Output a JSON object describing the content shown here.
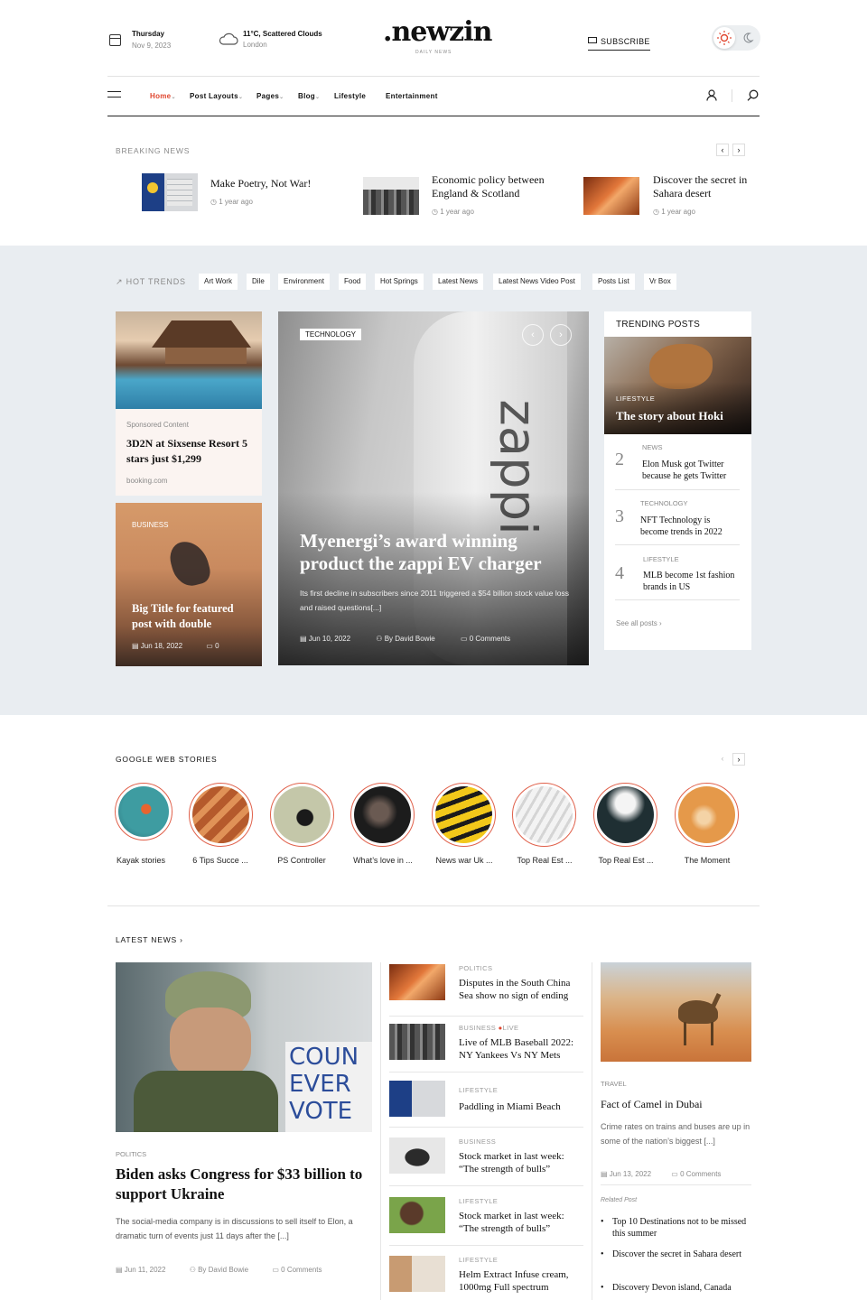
{
  "header": {
    "day": "Thursday",
    "date": "Nov 9, 2023",
    "weather": "11°C, Scattered Clouds",
    "city": "London",
    "logo": ".newzin",
    "logo_sub": "DAILY NEWS",
    "subscribe": "SUBSCRIBE"
  },
  "nav": {
    "items": [
      {
        "label": "Home",
        "active": true,
        "dropdown": true
      },
      {
        "label": "Post Layouts",
        "dropdown": true
      },
      {
        "label": "Pages",
        "dropdown": true
      },
      {
        "label": "Blog",
        "dropdown": true
      },
      {
        "label": "Lifestyle",
        "dropdown": false
      },
      {
        "label": "Entertainment",
        "dropdown": false
      }
    ]
  },
  "breaking": {
    "title": "BREAKING NEWS",
    "items": [
      {
        "title": "Make Poetry, Not War!",
        "time": "1 year ago"
      },
      {
        "title": "Economic policy between England & Scotland",
        "time": "1 year ago"
      },
      {
        "title": "Discover the secret in Sahara desert",
        "time": "1 year ago"
      }
    ]
  },
  "hot_trends": {
    "label": "HOT TRENDS",
    "tags": [
      "Art Work",
      "Dile",
      "Environment",
      "Food",
      "Hot Springs",
      "Latest News",
      "Latest News Video Post",
      "Posts List",
      "Vr Box"
    ]
  },
  "sponsored": {
    "label": "Sponsored Content",
    "title": "3D2N at Sixsense Resort 5 stars just $1,299",
    "source": "booking.com"
  },
  "feature_small": {
    "category": "BUSINESS",
    "title": "Big Title for featured post with double",
    "date": "Jun 18, 2022",
    "comments": "0"
  },
  "feature_main": {
    "category": "TECHNOLOGY",
    "title": "Myenergi’s award winning product the zappi EV charger",
    "excerpt": "Its first decline in subscribers since 2011 triggered a $54 billion stock value loss and raised questions[...]",
    "date": "Jun 10, 2022",
    "author": "By David Bowie",
    "comments": "0 Comments"
  },
  "trending": {
    "title": "TRENDING POSTS",
    "top": {
      "category": "LIFESTYLE",
      "title": "The story about Hoki"
    },
    "items": [
      {
        "num": "2",
        "category": "NEWS",
        "title": "Elon Musk got Twitter because he gets Twitter"
      },
      {
        "num": "3",
        "category": "TECHNOLOGY",
        "title": "NFT Technology is become trends in 2022"
      },
      {
        "num": "4",
        "category": "LIFESTYLE",
        "title": "MLB become 1st fashion brands in US"
      }
    ],
    "see_all": "See all posts"
  },
  "web_stories": {
    "title": "GOOGLE WEB STORIES",
    "items": [
      "Kayak stories",
      "6 Tips Succe ...",
      "PS Controller",
      "What’s love in ...",
      "News war Uk ...",
      "Top Real Est ...",
      "Top Real Est ...",
      "The Moment"
    ]
  },
  "latest": {
    "title": "LATEST NEWS",
    "main": {
      "category": "POLITICS",
      "title": "Biden asks Congress for $33 billion to support Ukraine",
      "excerpt": "The social-media company is in discussions to sell itself to Elon, a dramatic turn of events just 11 days after the [...]",
      "date": "Jun 11, 2022",
      "author": "By David Bowie",
      "comments": "0 Comments",
      "sign_text": "COUN EVER VOTE"
    },
    "side": [
      {
        "category": "POLITICS",
        "title": "Disputes in the South China Sea show no sign of ending"
      },
      {
        "category": "BUSINESS",
        "live": "LIVE",
        "title": "Live of MLB Baseball 2022: NY Yankees Vs NY Mets"
      },
      {
        "category": "LIFESTYLE",
        "title": "Paddling in Miami Beach"
      },
      {
        "category": "BUSINESS",
        "title": "Stock market in last week: “The strength of bulls”"
      },
      {
        "category": "LIFESTYLE",
        "title": "Stock market in last week: “The strength of bulls”"
      },
      {
        "category": "LIFESTYLE",
        "title": "Helm Extract Infuse cream, 1000mg Full spectrum"
      }
    ],
    "right": {
      "category": "TRAVEL",
      "title": "Fact of Camel in Dubai",
      "excerpt": "Crime rates on trains and buses are up in some of the nation’s biggest [...]",
      "date": "Jun 13, 2022",
      "comments": "0 Comments",
      "related_label": "Related Post",
      "related": [
        "Top 10 Destinations not to be missed this summer",
        "Discover the secret in Sahara desert",
        "Discovery Devon island, Canada"
      ]
    }
  },
  "colors": {
    "accent": "#e0462f",
    "band": "#e9edf1"
  }
}
